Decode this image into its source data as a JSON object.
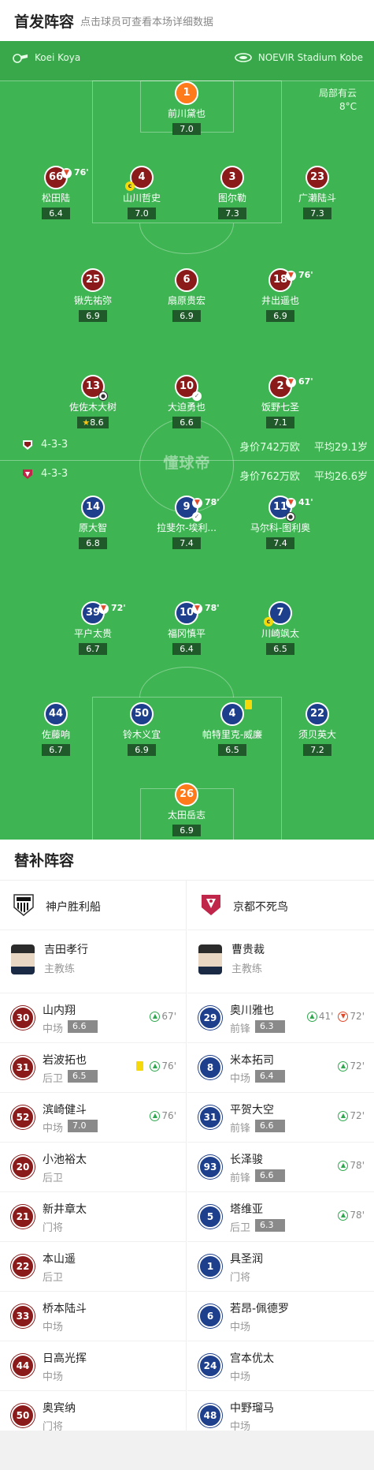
{
  "header": {
    "title": "首发阵容",
    "subtitle": "点击球员可查看本场详细数据"
  },
  "pitch": {
    "referee": "Koei Koya",
    "venue": "NOEVIR Stadium Kobe",
    "weather_desc": "局部有云",
    "temperature": "8°C",
    "watermark": "懂球帝",
    "home_team_bar": {
      "formation": "4-3-3",
      "value": "身价742万欧",
      "avg_age": "平均29.1岁"
    },
    "away_team_bar": {
      "formation": "4-3-3",
      "value": "身价762万欧",
      "avg_age": "平均26.6岁"
    }
  },
  "home_players": [
    {
      "num": "1",
      "name": "前川黛也",
      "rating": "7.0",
      "gk": true
    },
    {
      "num": "66",
      "name": "松田陆",
      "rating": "6.4",
      "sub": "76'"
    },
    {
      "num": "4",
      "name": "山川哲史",
      "rating": "7.0",
      "ycard": "c"
    },
    {
      "num": "3",
      "name": "图尔勒",
      "rating": "7.3"
    },
    {
      "num": "23",
      "name": "广濑陆斗",
      "rating": "7.3"
    },
    {
      "num": "25",
      "name": "锹先祐弥",
      "rating": "6.9"
    },
    {
      "num": "6",
      "name": "扇原贵宏",
      "rating": "6.9"
    },
    {
      "num": "18",
      "name": "井出遥也",
      "rating": "6.9",
      "sub": "76'"
    },
    {
      "num": "13",
      "name": "佐佐木大树",
      "rating": "8.6",
      "star": true
    },
    {
      "num": "10",
      "name": "大迫勇也",
      "rating": "6.6"
    },
    {
      "num": "2",
      "name": "饭野七圣",
      "rating": "7.1",
      "sub": "67'"
    }
  ],
  "away_players": [
    {
      "num": "14",
      "name": "原大智",
      "rating": "6.8"
    },
    {
      "num": "9",
      "name": "拉斐尔-埃利...",
      "rating": "7.4",
      "sub": "78'"
    },
    {
      "num": "11",
      "name": "马尔科-图利奥",
      "rating": "7.4",
      "sub": "41'"
    },
    {
      "num": "39",
      "name": "平户太贵",
      "rating": "6.7",
      "sub": "72'"
    },
    {
      "num": "10",
      "name": "福冈慎平",
      "rating": "6.4",
      "sub": "78'"
    },
    {
      "num": "7",
      "name": "川崎飒太",
      "rating": "6.5",
      "ycard": "c"
    },
    {
      "num": "44",
      "name": "佐藤响",
      "rating": "6.7"
    },
    {
      "num": "50",
      "name": "铃木义宜",
      "rating": "6.9"
    },
    {
      "num": "4",
      "name": "帕特里克-威廉",
      "rating": "6.5"
    },
    {
      "num": "22",
      "name": "须贝英大",
      "rating": "7.2"
    },
    {
      "num": "26",
      "name": "太田岳志",
      "rating": "6.9",
      "gk": true
    }
  ],
  "subs_section": {
    "title": "替补阵容"
  },
  "home_subs": {
    "team": "神户胜利船",
    "coach": {
      "name": "吉田孝行",
      "role": "主教练"
    },
    "players": [
      {
        "num": "30",
        "name": "山内翔",
        "pos": "中场",
        "rating": "6.6",
        "events": [
          {
            "type": "in",
            "min": "67'"
          }
        ]
      },
      {
        "num": "31",
        "name": "岩波拓也",
        "pos": "后卫",
        "rating": "6.5",
        "events": [
          {
            "type": "card",
            "min": ""
          },
          {
            "type": "in",
            "min": "76'"
          }
        ]
      },
      {
        "num": "52",
        "name": "滨崎健斗",
        "pos": "中场",
        "rating": "7.0",
        "events": [
          {
            "type": "in",
            "min": "76'"
          }
        ]
      },
      {
        "num": "20",
        "name": "小池裕太",
        "pos": "后卫"
      },
      {
        "num": "21",
        "name": "新井章太",
        "pos": "门将"
      },
      {
        "num": "22",
        "name": "本山遥",
        "pos": "后卫"
      },
      {
        "num": "33",
        "name": "桥本陆斗",
        "pos": "中场"
      },
      {
        "num": "44",
        "name": "日高光挥",
        "pos": "中场"
      },
      {
        "num": "50",
        "name": "奥宾纳",
        "pos": "门将"
      }
    ]
  },
  "away_subs": {
    "team": "京都不死鸟",
    "coach": {
      "name": "曹贵裁",
      "role": "主教练"
    },
    "players": [
      {
        "num": "29",
        "name": "奥川雅也",
        "pos": "前锋",
        "rating": "6.3",
        "events": [
          {
            "type": "in",
            "min": "41'"
          },
          {
            "type": "out",
            "min": "72'"
          }
        ]
      },
      {
        "num": "8",
        "name": "米本拓司",
        "pos": "中场",
        "rating": "6.4",
        "events": [
          {
            "type": "in",
            "min": "72'"
          }
        ]
      },
      {
        "num": "31",
        "name": "平贺大空",
        "pos": "前锋",
        "rating": "6.6",
        "events": [
          {
            "type": "in",
            "min": "72'"
          }
        ]
      },
      {
        "num": "93",
        "name": "长泽骏",
        "pos": "前锋",
        "rating": "6.6",
        "events": [
          {
            "type": "in",
            "min": "78'"
          }
        ]
      },
      {
        "num": "5",
        "name": "塔维亚",
        "pos": "后卫",
        "rating": "6.3",
        "events": [
          {
            "type": "in",
            "min": "78'"
          }
        ]
      },
      {
        "num": "1",
        "name": "具圣润",
        "pos": "门将"
      },
      {
        "num": "6",
        "name": "若昂-佩德罗",
        "pos": "中场"
      },
      {
        "num": "24",
        "name": "宫本优太",
        "pos": "中场"
      },
      {
        "num": "48",
        "name": "中野瑠马",
        "pos": "中场"
      }
    ]
  },
  "colors": {
    "pitch": "#3eb552",
    "home": "#8b1a1a",
    "away": "#1e3f8c",
    "gk": "#ff7a1a",
    "card": "#f5d90a",
    "sub_in": "#2fa84f",
    "sub_out": "#e14a2a"
  }
}
